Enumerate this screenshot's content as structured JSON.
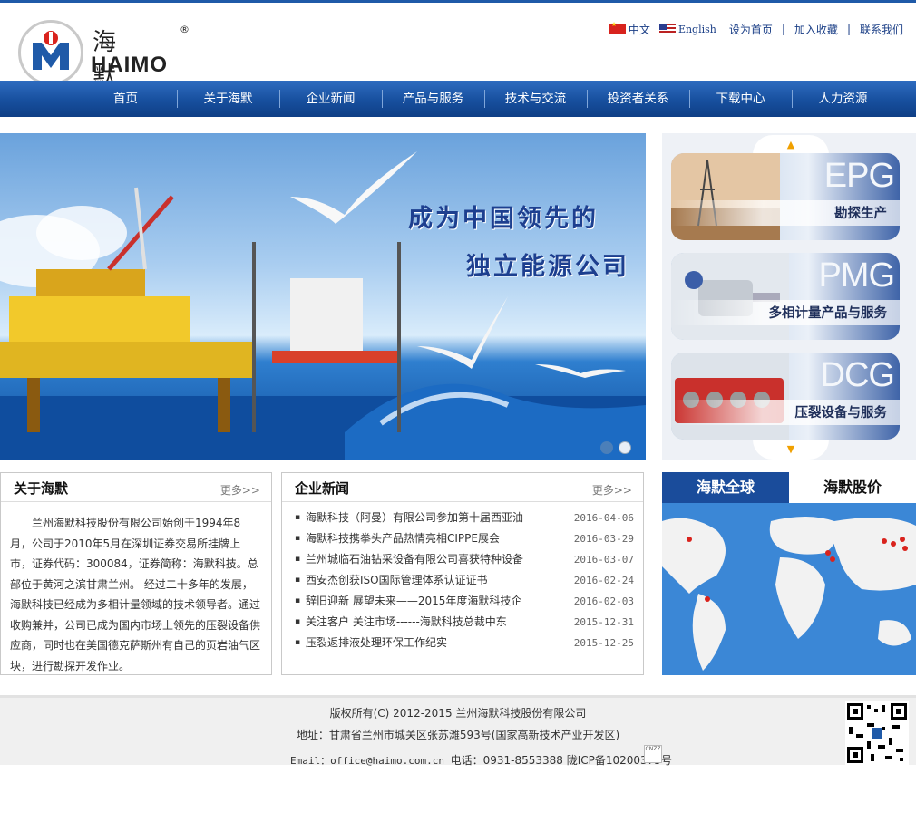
{
  "logo": {
    "cn": "海默",
    "reg": "®",
    "en": "HAIMO"
  },
  "toplinks": {
    "lang_cn": "中文",
    "lang_en": "English",
    "home": "设为首页",
    "favorite": "加入收藏",
    "contact": "联系我们",
    "sep": "|"
  },
  "nav": [
    "首页",
    "关于海默",
    "企业新闻",
    "产品与服务",
    "技术与交流",
    "投资者关系",
    "下载中心",
    "人力资源"
  ],
  "banner": {
    "line1": "成为中国领先的",
    "line2": "独立能源公司"
  },
  "side": {
    "up": "▲",
    "down": "▼",
    "cards": [
      {
        "code": "EPG",
        "label": "勘探生产"
      },
      {
        "code": "PMG",
        "label": "多相计量产品与服务"
      },
      {
        "code": "DCG",
        "label": "压裂设备与服务"
      }
    ]
  },
  "about": {
    "title": "关于海默",
    "more": "更多>>",
    "text": "兰州海默科技股份有限公司始创于1994年8月，公司于2010年5月在深圳证券交易所挂牌上市，证券代码：300084，证券简称：海默科技。总部位于黄河之滨甘肃兰州。 经过二十多年的发展，海默科技已经成为多相计量领域的技术领导者。通过收购兼并，公司已成为国内市场上领先的压裂设备供应商，同时也在美国德克萨斯州有自己的页岩油气区块，进行勘探开发作业。"
  },
  "news": {
    "title": "企业新闻",
    "more": "更多>>",
    "bullet": "▪",
    "items": [
      {
        "title": "海默科技（阿曼）有限公司参加第十届西亚油",
        "date": "2016-04-06"
      },
      {
        "title": "海默科技携拳头产品热情亮相CIPPE展会",
        "date": "2016-03-29"
      },
      {
        "title": "兰州城临石油钻采设备有限公司喜获特种设备",
        "date": "2016-03-07"
      },
      {
        "title": "西安杰创获ISO国际管理体系认证证书",
        "date": "2016-02-24"
      },
      {
        "title": "辞旧迎新 展望未来——2015年度海默科技企",
        "date": "2016-02-03"
      },
      {
        "title": "关注客户 关注市场------海默科技总裁中东",
        "date": "2015-12-31"
      },
      {
        "title": "压裂返排液处理环保工作纪实",
        "date": "2015-12-25"
      }
    ]
  },
  "global": {
    "tab1": "海默全球",
    "tab2": "海默股价"
  },
  "footer": {
    "copyright": "版权所有(C) 2012-2015 兰州海默科技股份有限公司",
    "address": "地址：甘肃省兰州市城关区张苏滩593号(国家高新技术产业开发区)",
    "email_label": "Email：office@haimo.com.cn",
    "phone": "电话：0931-8553388 陇ICP备10200375号",
    "cnzz": "CNZZ"
  },
  "colors": {
    "nav": "#1f5aa8",
    "tab_active": "#1a4c9b",
    "banner_text": "#1d3f8f"
  }
}
